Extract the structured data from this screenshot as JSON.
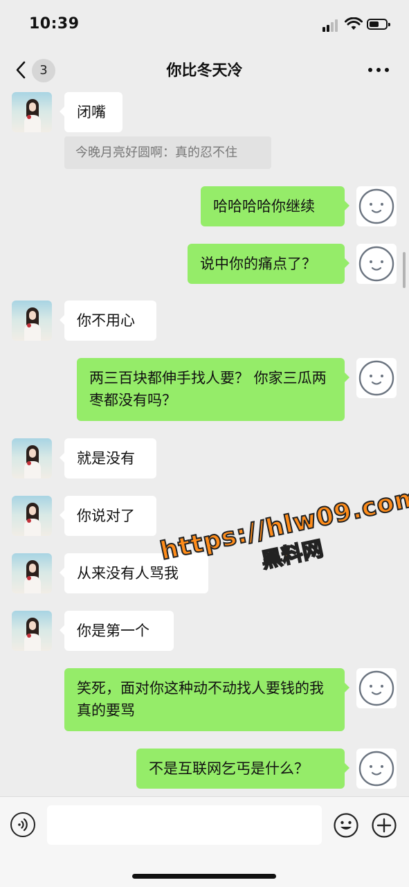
{
  "status_bar": {
    "time": "10:39"
  },
  "header": {
    "back_badge": "3",
    "title": "你比冬天冷"
  },
  "messages": [
    {
      "side": "left",
      "text": "闭嘴"
    },
    {
      "side": "left-quote",
      "text": "今晚月亮好圆啊：真的忍不住"
    },
    {
      "side": "right",
      "text": "哈哈哈哈你继续"
    },
    {
      "side": "right",
      "text": "说中你的痛点了？"
    },
    {
      "side": "left",
      "text": "你不用心"
    },
    {
      "side": "right",
      "text": "两三百块都伸手找人要？ 你家三瓜两枣都没有吗？"
    },
    {
      "side": "left",
      "text": "就是没有"
    },
    {
      "side": "left",
      "text": "你说对了"
    },
    {
      "side": "left",
      "text": "从来没有人骂我"
    },
    {
      "side": "left",
      "text": "你是第一个"
    },
    {
      "side": "right",
      "text": "笑死，面对你这种动不动找人要钱的我真的要骂"
    },
    {
      "side": "right",
      "text": "不是互联网乞丐是什么？"
    }
  ],
  "watermark": {
    "url": "https://hlw09.com",
    "label": "黑料网"
  },
  "input": {
    "value": "",
    "placeholder": ""
  },
  "colors": {
    "background": "#ededed",
    "self_bubble": "#95ec69",
    "other_bubble": "#ffffff",
    "quote_bg": "#e2e2e2"
  },
  "icons": {
    "back": "chevron-left-icon",
    "more": "more-dots-icon",
    "voice": "voice-icon",
    "emoji": "emoji-icon",
    "plus": "plus-icon"
  }
}
